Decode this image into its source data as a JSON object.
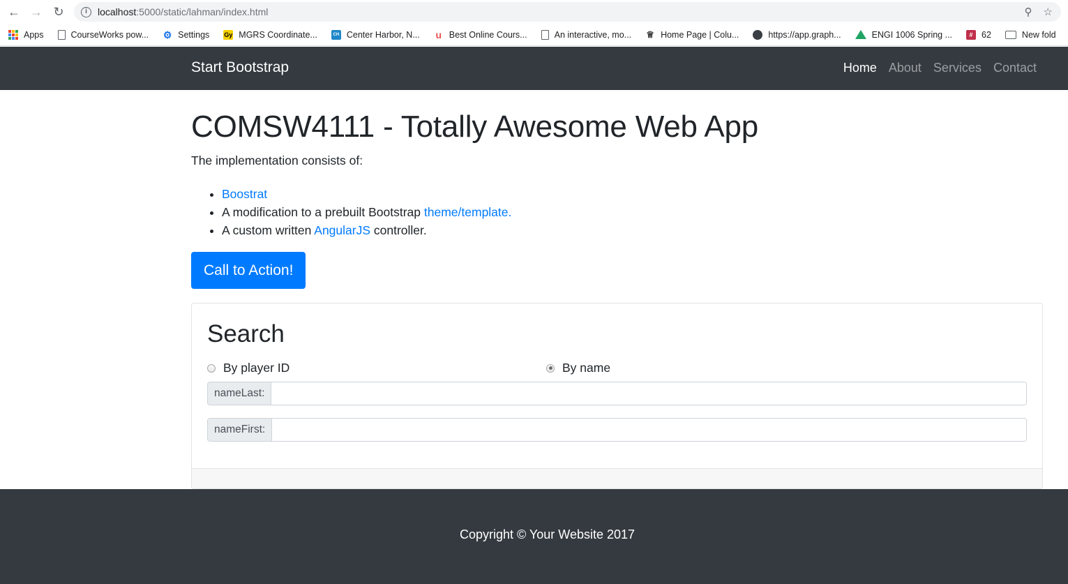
{
  "browser": {
    "url_host": "localhost",
    "url_path": ":5000/static/lahman/index.html",
    "bookmarks": [
      {
        "label": "Apps",
        "icon": "apps-grid-icon"
      },
      {
        "label": "CourseWorks pow...",
        "icon": "document-icon"
      },
      {
        "label": "Settings",
        "icon": "gear-icon"
      },
      {
        "label": "MGRS Coordinate...",
        "icon": "mgrs-icon"
      },
      {
        "label": "Center Harbor, N...",
        "icon": "harbor-icon"
      },
      {
        "label": "Best Online Cours...",
        "icon": "udemy-icon"
      },
      {
        "label": "An interactive, mo...",
        "icon": "document-icon"
      },
      {
        "label": "Home Page | Colu...",
        "icon": "crown-icon"
      },
      {
        "label": "https://app.graph...",
        "icon": "circle-icon"
      },
      {
        "label": "ENGI 1006 Spring ...",
        "icon": "drive-icon"
      },
      {
        "label": "62",
        "icon": "slack-icon"
      },
      {
        "label": "New fold",
        "icon": "folder-icon"
      }
    ]
  },
  "navbar": {
    "brand": "Start Bootstrap",
    "links": [
      {
        "label": "Home",
        "active": true
      },
      {
        "label": "About",
        "active": false
      },
      {
        "label": "Services",
        "active": false
      },
      {
        "label": "Contact",
        "active": false
      }
    ]
  },
  "main": {
    "title": "COMSW4111 - Totally Awesome Web App",
    "lead": "The implementation consists of:",
    "items": [
      {
        "prefix": "",
        "link": "Boostrat",
        "suffix": ""
      },
      {
        "prefix": "A modification to a prebuilt Bootstrap ",
        "link": "theme/template.",
        "suffix": ""
      },
      {
        "prefix": "A custom written ",
        "link": "AngularJS",
        "suffix": " controller."
      }
    ],
    "cta": "Call to Action!"
  },
  "search": {
    "title": "Search",
    "radio_player_id": "By player ID",
    "radio_name": "By name",
    "selected": "By name",
    "name_last_label": "nameLast:",
    "name_last_value": "",
    "name_first_label": "nameFirst:",
    "name_first_value": ""
  },
  "footer": {
    "copyright": "Copyright © Your Website 2017"
  },
  "colors": {
    "navbar_bg": "#343a40",
    "primary": "#007bff"
  }
}
